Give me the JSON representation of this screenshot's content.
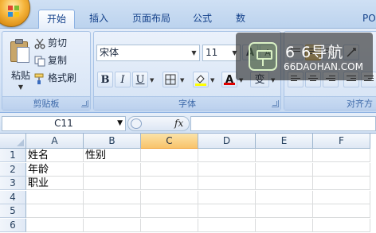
{
  "tabs": [
    {
      "label": "开始",
      "active": true
    },
    {
      "label": "插入",
      "active": false
    },
    {
      "label": "页面布局",
      "active": false
    },
    {
      "label": "公式",
      "active": false
    },
    {
      "label": "数",
      "active": false
    },
    {
      "label": "PO",
      "active": false
    }
  ],
  "clipboard": {
    "paste_label": "粘贴",
    "cut_label": "剪切",
    "copy_label": "复制",
    "format_painter_label": "格式刷",
    "group_label": "剪贴板"
  },
  "font": {
    "name": "宋体",
    "size": "11",
    "bold_label": "B",
    "italic_label": "I",
    "underline_label": "U",
    "font_color_label": "A",
    "phonetic_label": "变",
    "grow_label": "A",
    "shrink_label": "A",
    "group_label": "字体"
  },
  "alignment": {
    "group_label": "对齐方"
  },
  "watermark": {
    "title": "6 6导航",
    "subtitle": "66DAOHAN.COM"
  },
  "formula_bar": {
    "name_box": "C11",
    "fx_label": "fx",
    "formula": ""
  },
  "sheet": {
    "columns": [
      "A",
      "B",
      "C",
      "D",
      "E",
      "F"
    ],
    "selected_column": "C",
    "rows": [
      {
        "num": "1",
        "cells": [
          "姓名",
          "性别",
          "",
          "",
          "",
          ""
        ]
      },
      {
        "num": "2",
        "cells": [
          "年龄",
          "",
          "",
          "",
          "",
          ""
        ]
      },
      {
        "num": "3",
        "cells": [
          "职业",
          "",
          "",
          "",
          "",
          ""
        ]
      },
      {
        "num": "4",
        "cells": [
          "",
          "",
          "",
          "",
          "",
          ""
        ]
      },
      {
        "num": "5",
        "cells": [
          "",
          "",
          "",
          "",
          "",
          ""
        ]
      },
      {
        "num": "6",
        "cells": [
          "",
          "",
          "",
          "",
          "",
          ""
        ]
      }
    ]
  },
  "colors": {
    "accent": "#15428b",
    "ribbon_bg": "#d6e4f6",
    "selected_header": "#f8c36b",
    "font_color_swatch": "#e00000",
    "highlight_swatch": "#ffff00"
  }
}
